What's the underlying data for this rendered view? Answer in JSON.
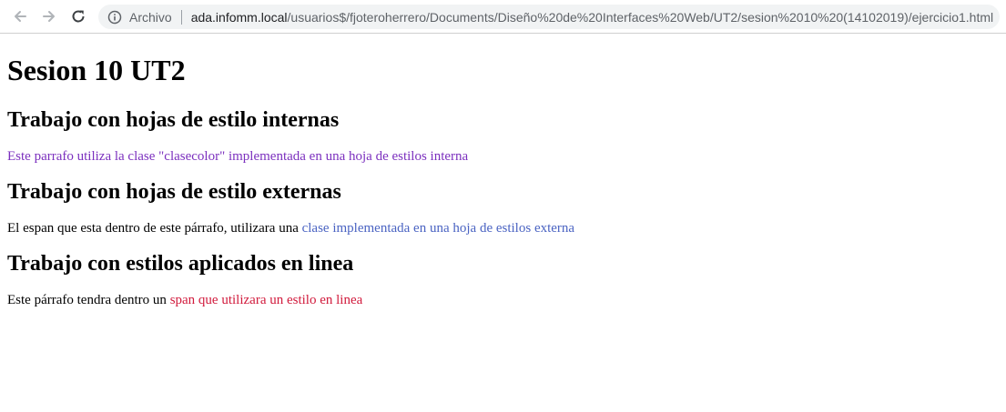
{
  "browser": {
    "back_icon": "arrow-left-icon",
    "forward_icon": "arrow-right-icon",
    "reload_icon": "reload-icon",
    "info_icon": "info-icon",
    "origin_label": "Archivo",
    "url_host": "ada.infomm.local",
    "url_path": "/usuarios$/fjoteroherrero/Documents/Diseño%20de%20Interfaces%20Web/UT2/sesion%2010%20(14102019)/ejercicio1.html"
  },
  "page": {
    "title": "Sesion 10 UT2",
    "section_internal": {
      "heading": "Trabajo con hojas de estilo internas",
      "paragraph": "Este parrafo utiliza la clase \"clasecolor\" implementada en una hoja de estilos interna",
      "color": "#7b2fbe"
    },
    "section_external": {
      "heading": "Trabajo con hojas de estilo externas",
      "paragraph_prefix": "El espan que esta dentro de este párrafo, utilizara una ",
      "span_text": "clase implementada en una hoja de estilos externa",
      "color": "#4a63c2"
    },
    "section_inline": {
      "heading": "Trabajo con estilos aplicados en linea",
      "paragraph_prefix": "Este párrafo tendra dentro un ",
      "span_text": "span que utilizara un estilo en linea",
      "color": "#d11a3c"
    }
  }
}
